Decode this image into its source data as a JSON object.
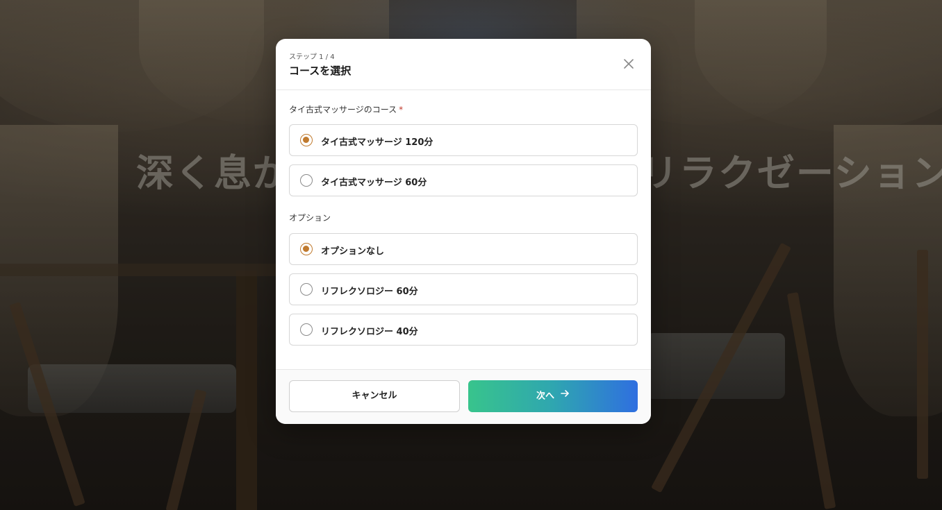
{
  "background": {
    "hero_text": "深く息がすっと入るような、リラクゼーションを。"
  },
  "modal": {
    "step_label": "ステップ 1 / 4",
    "title": "コースを選択",
    "close_icon": "close-icon",
    "course_section": {
      "label": "タイ古式マッサージのコース",
      "required_mark": "*",
      "options": [
        {
          "label": "タイ古式マッサージ 120分",
          "selected": true
        },
        {
          "label": "タイ古式マッサージ 60分",
          "selected": false
        }
      ]
    },
    "option_section": {
      "label": "オプション",
      "options": [
        {
          "label": "オプションなし",
          "selected": true
        },
        {
          "label": "リフレクソロジー 60分",
          "selected": false
        },
        {
          "label": "リフレクソロジー 40分",
          "selected": false
        }
      ]
    },
    "footer": {
      "cancel_label": "キャンセル",
      "next_label": "次へ",
      "next_icon": "arrow-right-icon"
    }
  },
  "colors": {
    "accent_radio": "#c07a2e",
    "next_gradient_start": "#38c48c",
    "next_gradient_end": "#2f6fe0"
  }
}
